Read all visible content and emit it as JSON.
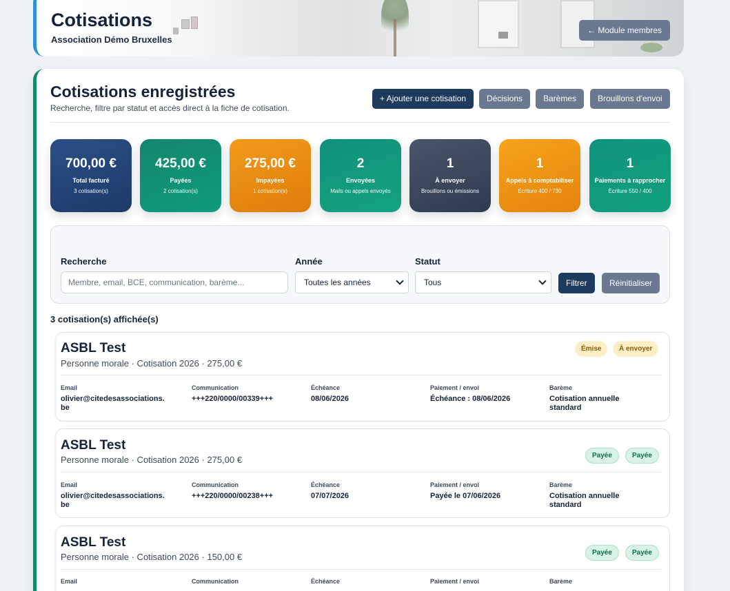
{
  "header": {
    "title": "Cotisations",
    "subtitle": "Association Démo Bruxelles",
    "back_button": "← Module membres"
  },
  "main": {
    "title": "Cotisations enregistrées",
    "subtitle": "Recherche, filtre par statut et accès direct à la fiche de cotisation.",
    "toolbar": {
      "add": "+ Ajouter une cotisation",
      "decisions": "Décisions",
      "baremes": "Barèmes",
      "drafts": "Brouillons d'envoi"
    }
  },
  "stats": [
    {
      "value": "700,00 €",
      "label": "Total facturé",
      "hint": "3 cotisation(s)"
    },
    {
      "value": "425,00 €",
      "label": "Payées",
      "hint": "2 cotisation(s)"
    },
    {
      "value": "275,00 €",
      "label": "Impayées",
      "hint": "1 cotisation(s)"
    },
    {
      "value": "2",
      "label": "Envoyées",
      "hint": "Mails ou appels envoyés"
    },
    {
      "value": "1",
      "label": "À envoyer",
      "hint": "Brouillons ou émissions"
    },
    {
      "value": "1",
      "label": "Appels à comptabiliser",
      "hint": "Écriture 400 / 730"
    },
    {
      "value": "1",
      "label": "Paiements à rapprocher",
      "hint": "Écriture 550 / 400"
    }
  ],
  "filters": {
    "search_label": "Recherche",
    "search_placeholder": "Membre, email, BCE, communication, barème...",
    "year_label": "Année",
    "year_value": "Toutes les années",
    "status_label": "Statut",
    "status_value": "Tous",
    "filter_button": "Filtrer",
    "reset_button": "Réinitialiser"
  },
  "list": {
    "count_text": "3 cotisation(s) affichée(s)",
    "field_headers": {
      "email": "Email",
      "communication": "Communication",
      "due": "Échéance",
      "payment": "Paiement / envoi",
      "bareme": "Barème"
    },
    "records": [
      {
        "name": "ASBL Test",
        "meta": "Personne morale · Cotisation 2026 · 275,00 €",
        "badges": [
          "Émise",
          "À envoyer"
        ],
        "email_line1": "olivier@citedesassociations.",
        "email_line2": "be",
        "communication": "+++220/0000/00339+++",
        "due": "08/06/2026",
        "payment": "Échéance : 08/06/2026",
        "bareme_line1": "Cotisation annuelle",
        "bareme_line2": "standard"
      },
      {
        "name": "ASBL Test",
        "meta": "Personne morale · Cotisation 2026 · 275,00 €",
        "badges": [
          "Payée",
          "Payée"
        ],
        "email_line1": "olivier@citedesassociations.",
        "email_line2": "be",
        "communication": "+++220/0000/00238+++",
        "due": "07/07/2026",
        "payment": "Payée le 07/06/2026",
        "bareme_line1": "Cotisation annuelle",
        "bareme_line2": "standard"
      },
      {
        "name": "ASBL Test",
        "meta": "Personne morale · Cotisation 2026 · 150,00 €",
        "badges": [
          "Payée",
          "Payée"
        ]
      }
    ]
  }
}
